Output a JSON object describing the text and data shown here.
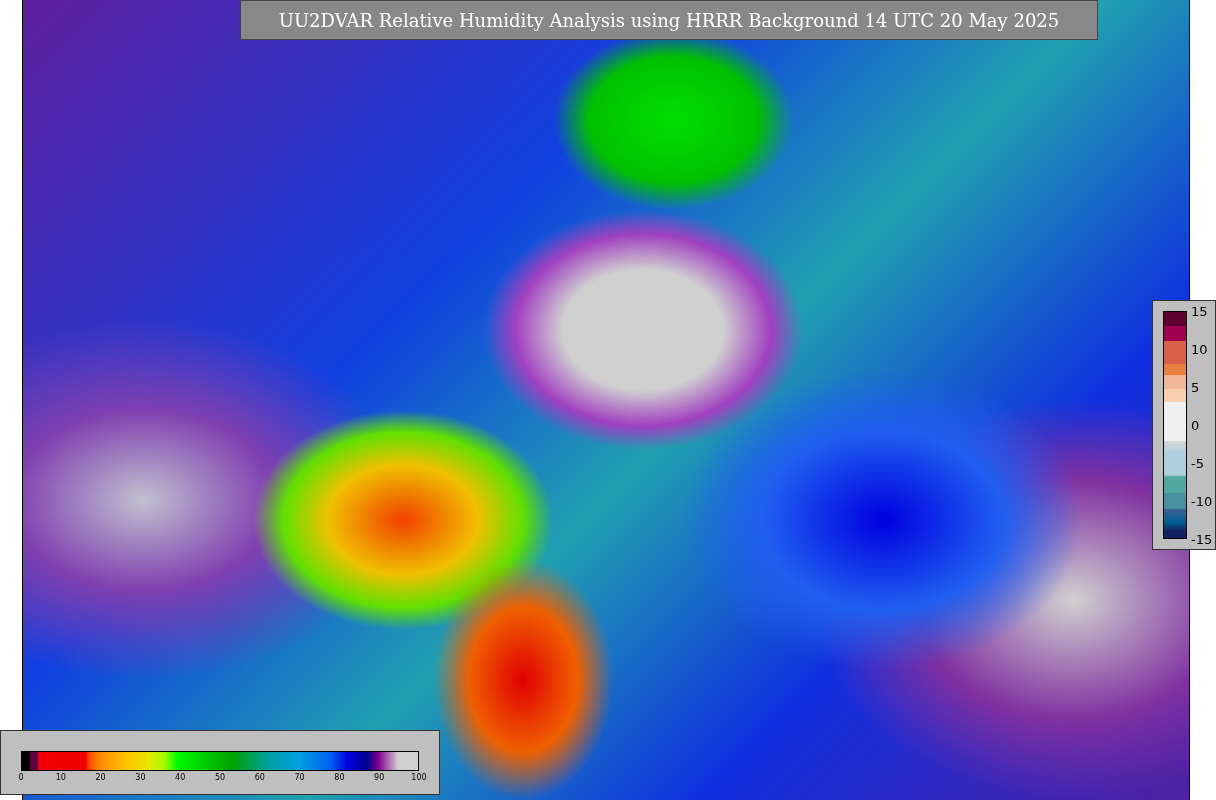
{
  "title": "UU2DVAR Relative Humidity Analysis using HRRR Background 14 UTC 20 May 2025",
  "humidity_legend": {
    "ticks": [
      "0",
      "10",
      "20",
      "30",
      "40",
      "50",
      "60",
      "70",
      "80",
      "90",
      "100"
    ]
  },
  "difference_legend": {
    "ticks": [
      "15",
      "10",
      "5",
      "0",
      "-5",
      "-10",
      "-15"
    ]
  }
}
